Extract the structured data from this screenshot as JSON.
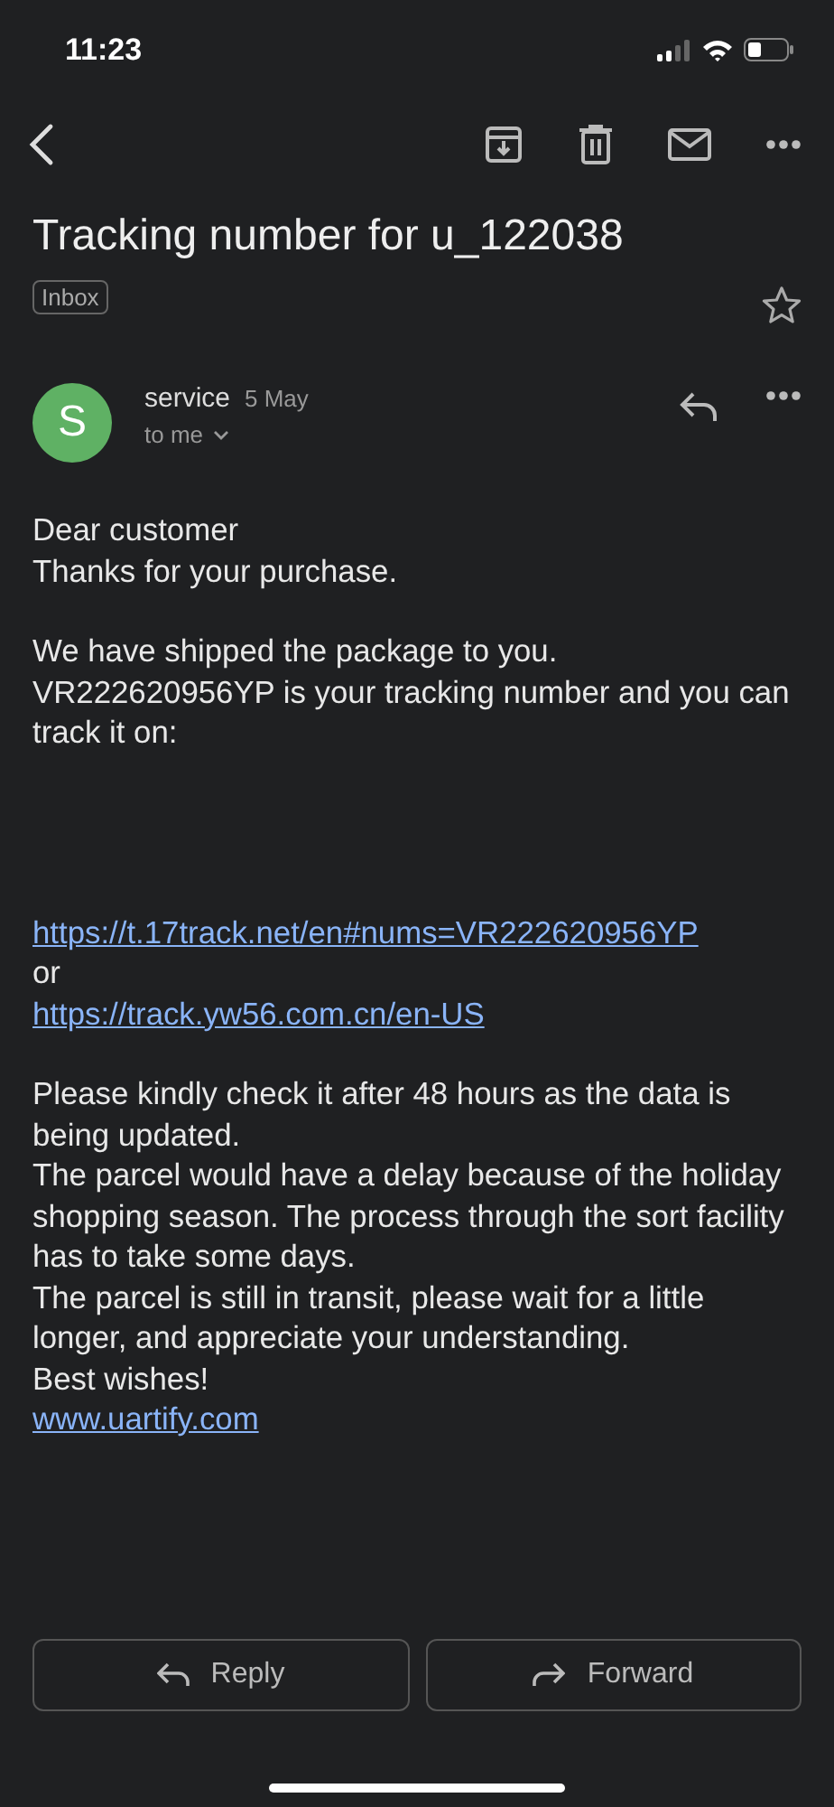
{
  "status_bar": {
    "time": "11:23"
  },
  "subject": "Tracking number for u_122038",
  "label": "Inbox",
  "starred": false,
  "message": {
    "avatar": "S",
    "sender": "service",
    "date": "5 May",
    "recipient": "to me"
  },
  "body": [
    {
      "lines": [
        {
          "kind": "text",
          "text": "Dear customer"
        },
        {
          "kind": "text",
          "text": "Thanks for your purchase."
        }
      ]
    },
    {
      "lines": [
        {
          "kind": "text",
          "text": "We have shipped the package to you."
        },
        {
          "kind": "text",
          "text": "VR222620956YP is your tracking number and you can track it on:"
        }
      ]
    },
    {
      "lines": [
        {
          "kind": "link",
          "text": "https://t.17track.net/en#nums=VR222620956YP"
        },
        {
          "kind": "text",
          "text": "or"
        },
        {
          "kind": "link",
          "text": "https://track.yw56.com.cn/en-US"
        }
      ]
    },
    {
      "lines": [
        {
          "kind": "text",
          "text": "Please kindly check it after 48 hours as the data is being updated."
        },
        {
          "kind": "text",
          "text": "The parcel would have a delay because of the holiday shopping season. The process through the sort facility has to take some days."
        },
        {
          "kind": "text",
          "text": "The parcel is still in transit, please wait for a little longer, and appreciate your understanding."
        },
        {
          "kind": "text",
          "text": "Best wishes!"
        },
        {
          "kind": "link",
          "text": "www.uartify.com"
        }
      ]
    }
  ],
  "actions": [
    {
      "kind": "reply",
      "label": "Reply"
    },
    {
      "kind": "forward",
      "label": "Forward"
    }
  ]
}
